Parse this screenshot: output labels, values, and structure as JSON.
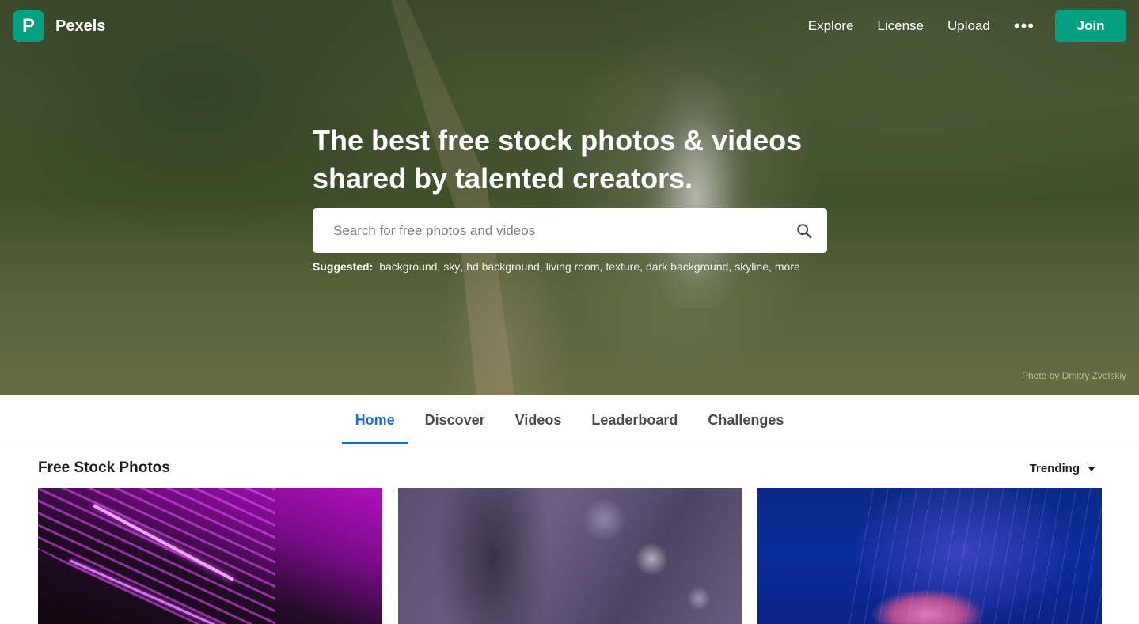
{
  "brand": {
    "name": "Pexels",
    "logo_letter": "P",
    "color": "#05a081"
  },
  "nav": {
    "explore": "Explore",
    "license": "License",
    "upload": "Upload",
    "more": "•••",
    "join": "Join"
  },
  "hero": {
    "headline_line1": "The best free stock photos & videos",
    "headline_line2": "shared by talented creators.",
    "search_placeholder": "Search for free photos and videos",
    "suggested_label": "Suggested:",
    "suggestions": [
      "background",
      "sky",
      "hd background",
      "living room",
      "texture",
      "dark background",
      "skyline",
      "more"
    ],
    "credit": "Photo by Dmitry Zvolskiy"
  },
  "tabs": [
    {
      "label": "Home",
      "active": true
    },
    {
      "label": "Discover",
      "active": false
    },
    {
      "label": "Videos",
      "active": false
    },
    {
      "label": "Leaderboard",
      "active": false
    },
    {
      "label": "Challenges",
      "active": false
    }
  ],
  "main": {
    "title": "Free Stock Photos",
    "sort_label": "Trending"
  },
  "colors": {
    "active_tab": "#1a6cd9",
    "join_button": "#05a081"
  }
}
